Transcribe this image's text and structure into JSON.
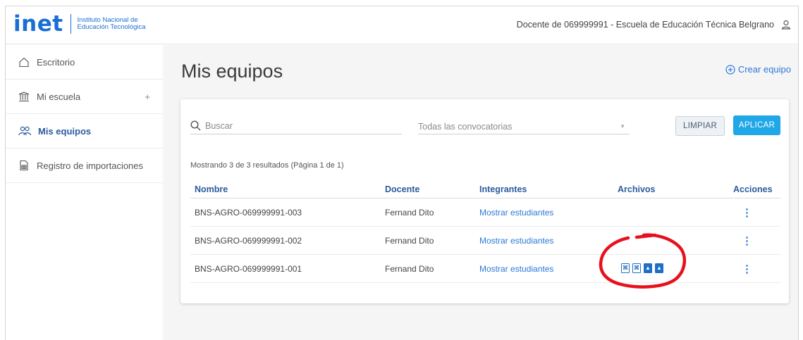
{
  "header": {
    "logo_word": "inet",
    "logo_line1": "Instituto Nacional de",
    "logo_line2": "Educación Tecnológica",
    "user_text": "Docente de 069999991 - Escuela de Educación Técnica Belgrano",
    "user_icon": "user-icon"
  },
  "sidebar": {
    "items": [
      {
        "label": "Escritorio",
        "icon": "home-icon"
      },
      {
        "label": "Mi escuela",
        "icon": "school-icon",
        "expand": "+"
      },
      {
        "label": "Mis equipos",
        "icon": "team-icon",
        "active": true
      },
      {
        "label": "Registro de importaciones",
        "icon": "import-log-icon"
      }
    ]
  },
  "main": {
    "title": "Mis equipos",
    "create_label": "Crear equipo",
    "search_placeholder": "Buscar",
    "select_value": "Todas las convocatorias",
    "clear_label": "LIMPIAR",
    "apply_label": "APLICAR",
    "results_text": "Mostrando 3 de 3 resultados (Página 1 de 1)",
    "columns": [
      "Nombre",
      "Docente",
      "Integrantes",
      "Archivos",
      "Acciones"
    ],
    "rows": [
      {
        "nombre": "BNS-AGRO-069999991-003",
        "docente": "Fernand Dito",
        "integrantes": "Mostrar estudiantes",
        "archivos": []
      },
      {
        "nombre": "BNS-AGRO-069999991-002",
        "docente": "Fernand Dito",
        "integrantes": "Mostrar estudiantes",
        "archivos": []
      },
      {
        "nombre": "BNS-AGRO-069999991-001",
        "docente": "Fernand Dito",
        "integrantes": "Mostrar estudiantes",
        "archivos": [
          "pdf-file-icon",
          "pdf-file-icon",
          "image-file-icon",
          "image-file-icon"
        ]
      }
    ],
    "actions_glyph": "⋮"
  },
  "colors": {
    "brand": "#1a6fd4",
    "link": "#2b78d8",
    "apply": "#1fa7e8",
    "annotation": "#e8101c"
  }
}
